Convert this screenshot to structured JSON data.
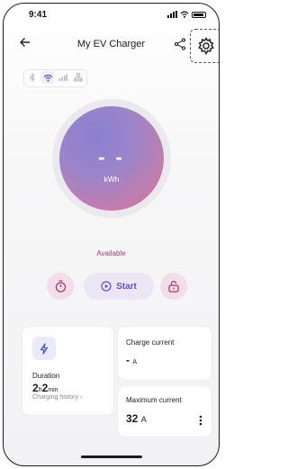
{
  "status_bar": {
    "time": "9:41"
  },
  "header": {
    "title": "My EV Charger",
    "back_icon": "arrow-left-icon",
    "share_icon": "share-icon",
    "settings_icon": "gear-icon"
  },
  "connectivity": {
    "items": [
      "bluetooth-icon",
      "wifi-icon",
      "cellular-icon",
      "ethernet-icon"
    ],
    "active": "wifi-icon"
  },
  "meter": {
    "value": "- -",
    "unit": "kWh",
    "gradient": [
      "#8a80d2",
      "#d37797"
    ]
  },
  "status": {
    "text": "Available",
    "color": "#a13a78"
  },
  "actions": {
    "timer_icon": "timer-icon",
    "start_label": "Start",
    "unlock_icon": "unlock-icon"
  },
  "duration_card": {
    "label": "Duration",
    "hours": "2",
    "hours_unit": "h",
    "minutes": "2",
    "minutes_unit": "min",
    "history_label": "Charging history  ›"
  },
  "charge_current_card": {
    "label": "Charge current",
    "value": "-",
    "unit": "A"
  },
  "max_current_card": {
    "label": "Maximum current",
    "value": "32",
    "unit": "A"
  },
  "accent": "#6a4fc8"
}
